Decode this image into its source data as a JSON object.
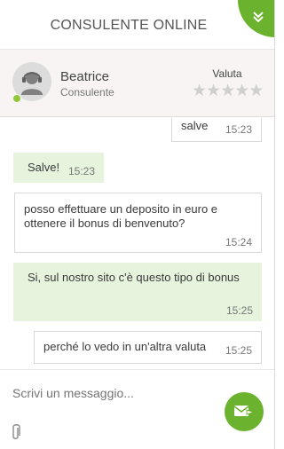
{
  "header": {
    "title": "CONSULENTE ONLINE",
    "collapse_icon": "double-chevron-down-icon"
  },
  "agent": {
    "name": "Beatrice",
    "role": "Consulente",
    "status": "online"
  },
  "rating": {
    "label": "Valuta",
    "stars_total": 5,
    "stars_filled": 0
  },
  "messages": [
    {
      "from": "user",
      "text": "salve",
      "time": "15:23"
    },
    {
      "from": "agent",
      "text": "Salve!",
      "time": "15:23"
    },
    {
      "from": "user",
      "text": "posso effettuare un deposito in euro e ottenere il bonus di benvenuto?",
      "time": "15:24"
    },
    {
      "from": "agent",
      "text": "Si, sul nostro sito c'è questo tipo di bonus",
      "time": "15:25"
    },
    {
      "from": "user",
      "text": "perché lo vedo in un'altra valuta",
      "time": "15:25"
    }
  ],
  "composer": {
    "placeholder": "Scrivi un messaggio...",
    "send_icon": "send-mail-icon",
    "attach_icon": "paperclip-icon"
  },
  "colors": {
    "accent": "#6bb32e",
    "agent_bubble": "#e6f4dd",
    "online": "#8fc93a"
  }
}
